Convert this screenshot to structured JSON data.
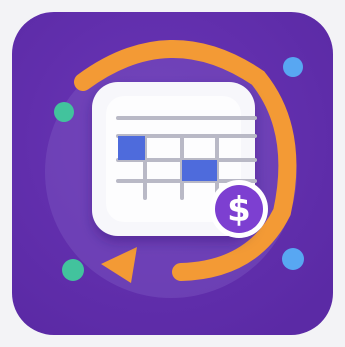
{
  "icon": {
    "name": "spreadsheet-billing-cycle-app-icon",
    "currency_symbol": "$",
    "colors": {
      "background": "#5b2aa5",
      "background_light": "#6a35b7",
      "halo": "#7d57c1",
      "orange": "#f39a35",
      "card": "#f7f7fb",
      "grid": "#b9b9c6",
      "blue": "#4e6bdc",
      "green": "#42c39d",
      "sky": "#58a7f2",
      "badge": "#7d3fd1"
    }
  }
}
